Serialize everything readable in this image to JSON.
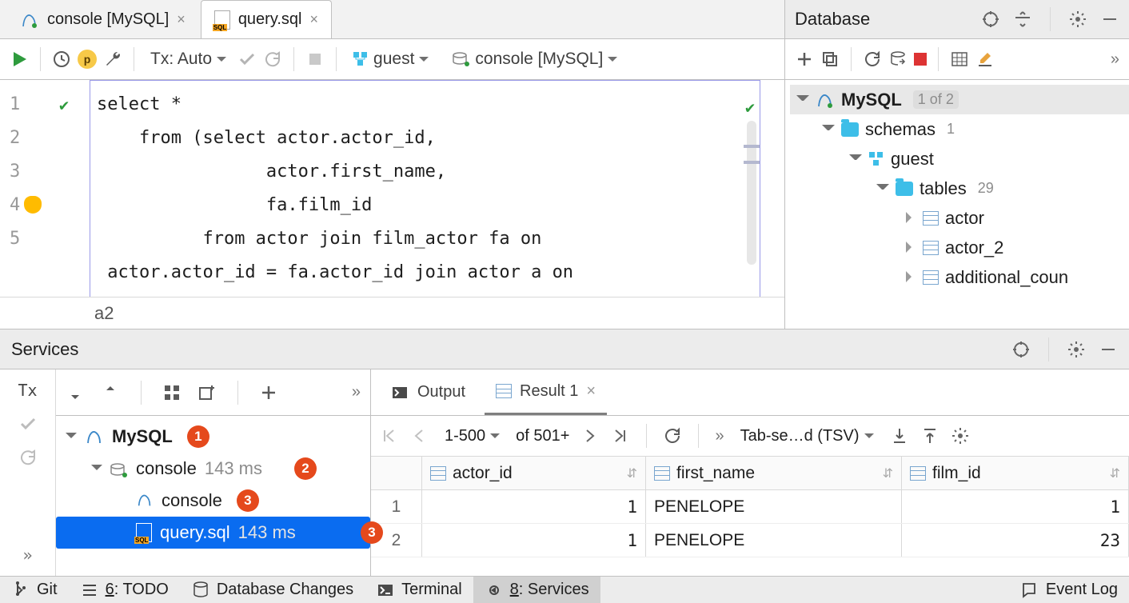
{
  "editor": {
    "tabs": [
      {
        "label": "console [MySQL]",
        "active": false
      },
      {
        "label": "query.sql",
        "active": true
      }
    ],
    "toolbar": {
      "tx_label": "Tx: Auto",
      "schema_dd": "guest",
      "console_dd": "console [MySQL]"
    },
    "code": {
      "lines": [
        {
          "n": "1",
          "html": "<span class='kw'>select</span> *"
        },
        {
          "n": "2",
          "html": "    <span class='kw'>from</span> (<span class='kw'>select</span> actor.<span class='id'>actor_id</span>,"
        },
        {
          "n": "3",
          "html": "                actor.<span class='id'>first_name</span>,"
        },
        {
          "n": "4",
          "html": "                fa.<span class='id sel'>film_id</span>"
        },
        {
          "n": "5",
          "html": "          <span class='kw'>from</span> actor <span class='kw'>join</span> film_actor fa <span class='kw'>on</span>"
        },
        {
          "n": "",
          "html": " actor.<span class='id'>actor_id</span> = fa.<span class='id'>actor_id</span> <span class='kw'>join</span> actor a <span class='kw'>on</span>"
        }
      ]
    },
    "breadcrumb": "a2"
  },
  "database": {
    "title": "Database",
    "tree": {
      "root_label": "MySQL",
      "root_badge": "1 of 2",
      "schemas_label": "schemas",
      "schemas_cnt": "1",
      "schema_name": "guest",
      "tables_label": "tables",
      "tables_cnt": "29",
      "tables": [
        "actor",
        "actor_2",
        "additional_coun"
      ]
    }
  },
  "services": {
    "title": "Services",
    "mid_toolbar_tx": "Tx",
    "tree": {
      "root": "MySQL",
      "console": "console",
      "console_ms": "143 ms",
      "child_console": "console",
      "query": "query.sql",
      "query_ms": "143 ms"
    },
    "annotations": {
      "a1": "1",
      "a2": "2",
      "a3": "3",
      "a4": "3"
    },
    "right": {
      "tab_output": "Output",
      "tab_result": "Result 1",
      "pager": {
        "range_label": "1-500",
        "of_label": "of 501+",
        "export_label": "Tab-se…d (TSV)"
      },
      "columns": [
        "actor_id",
        "first_name",
        "film_id"
      ],
      "rows": [
        {
          "n": "1",
          "actor_id": "1",
          "first_name": "PENELOPE",
          "film_id": "1"
        },
        {
          "n": "2",
          "actor_id": "1",
          "first_name": "PENELOPE",
          "film_id": "23"
        }
      ]
    }
  },
  "status": {
    "git": "Git",
    "todo_u": "6",
    "todo_rest": ": TODO",
    "dbchanges": "Database Changes",
    "terminal": "Terminal",
    "services_u": "8",
    "services_rest": ": Services",
    "eventlog": "Event Log"
  }
}
